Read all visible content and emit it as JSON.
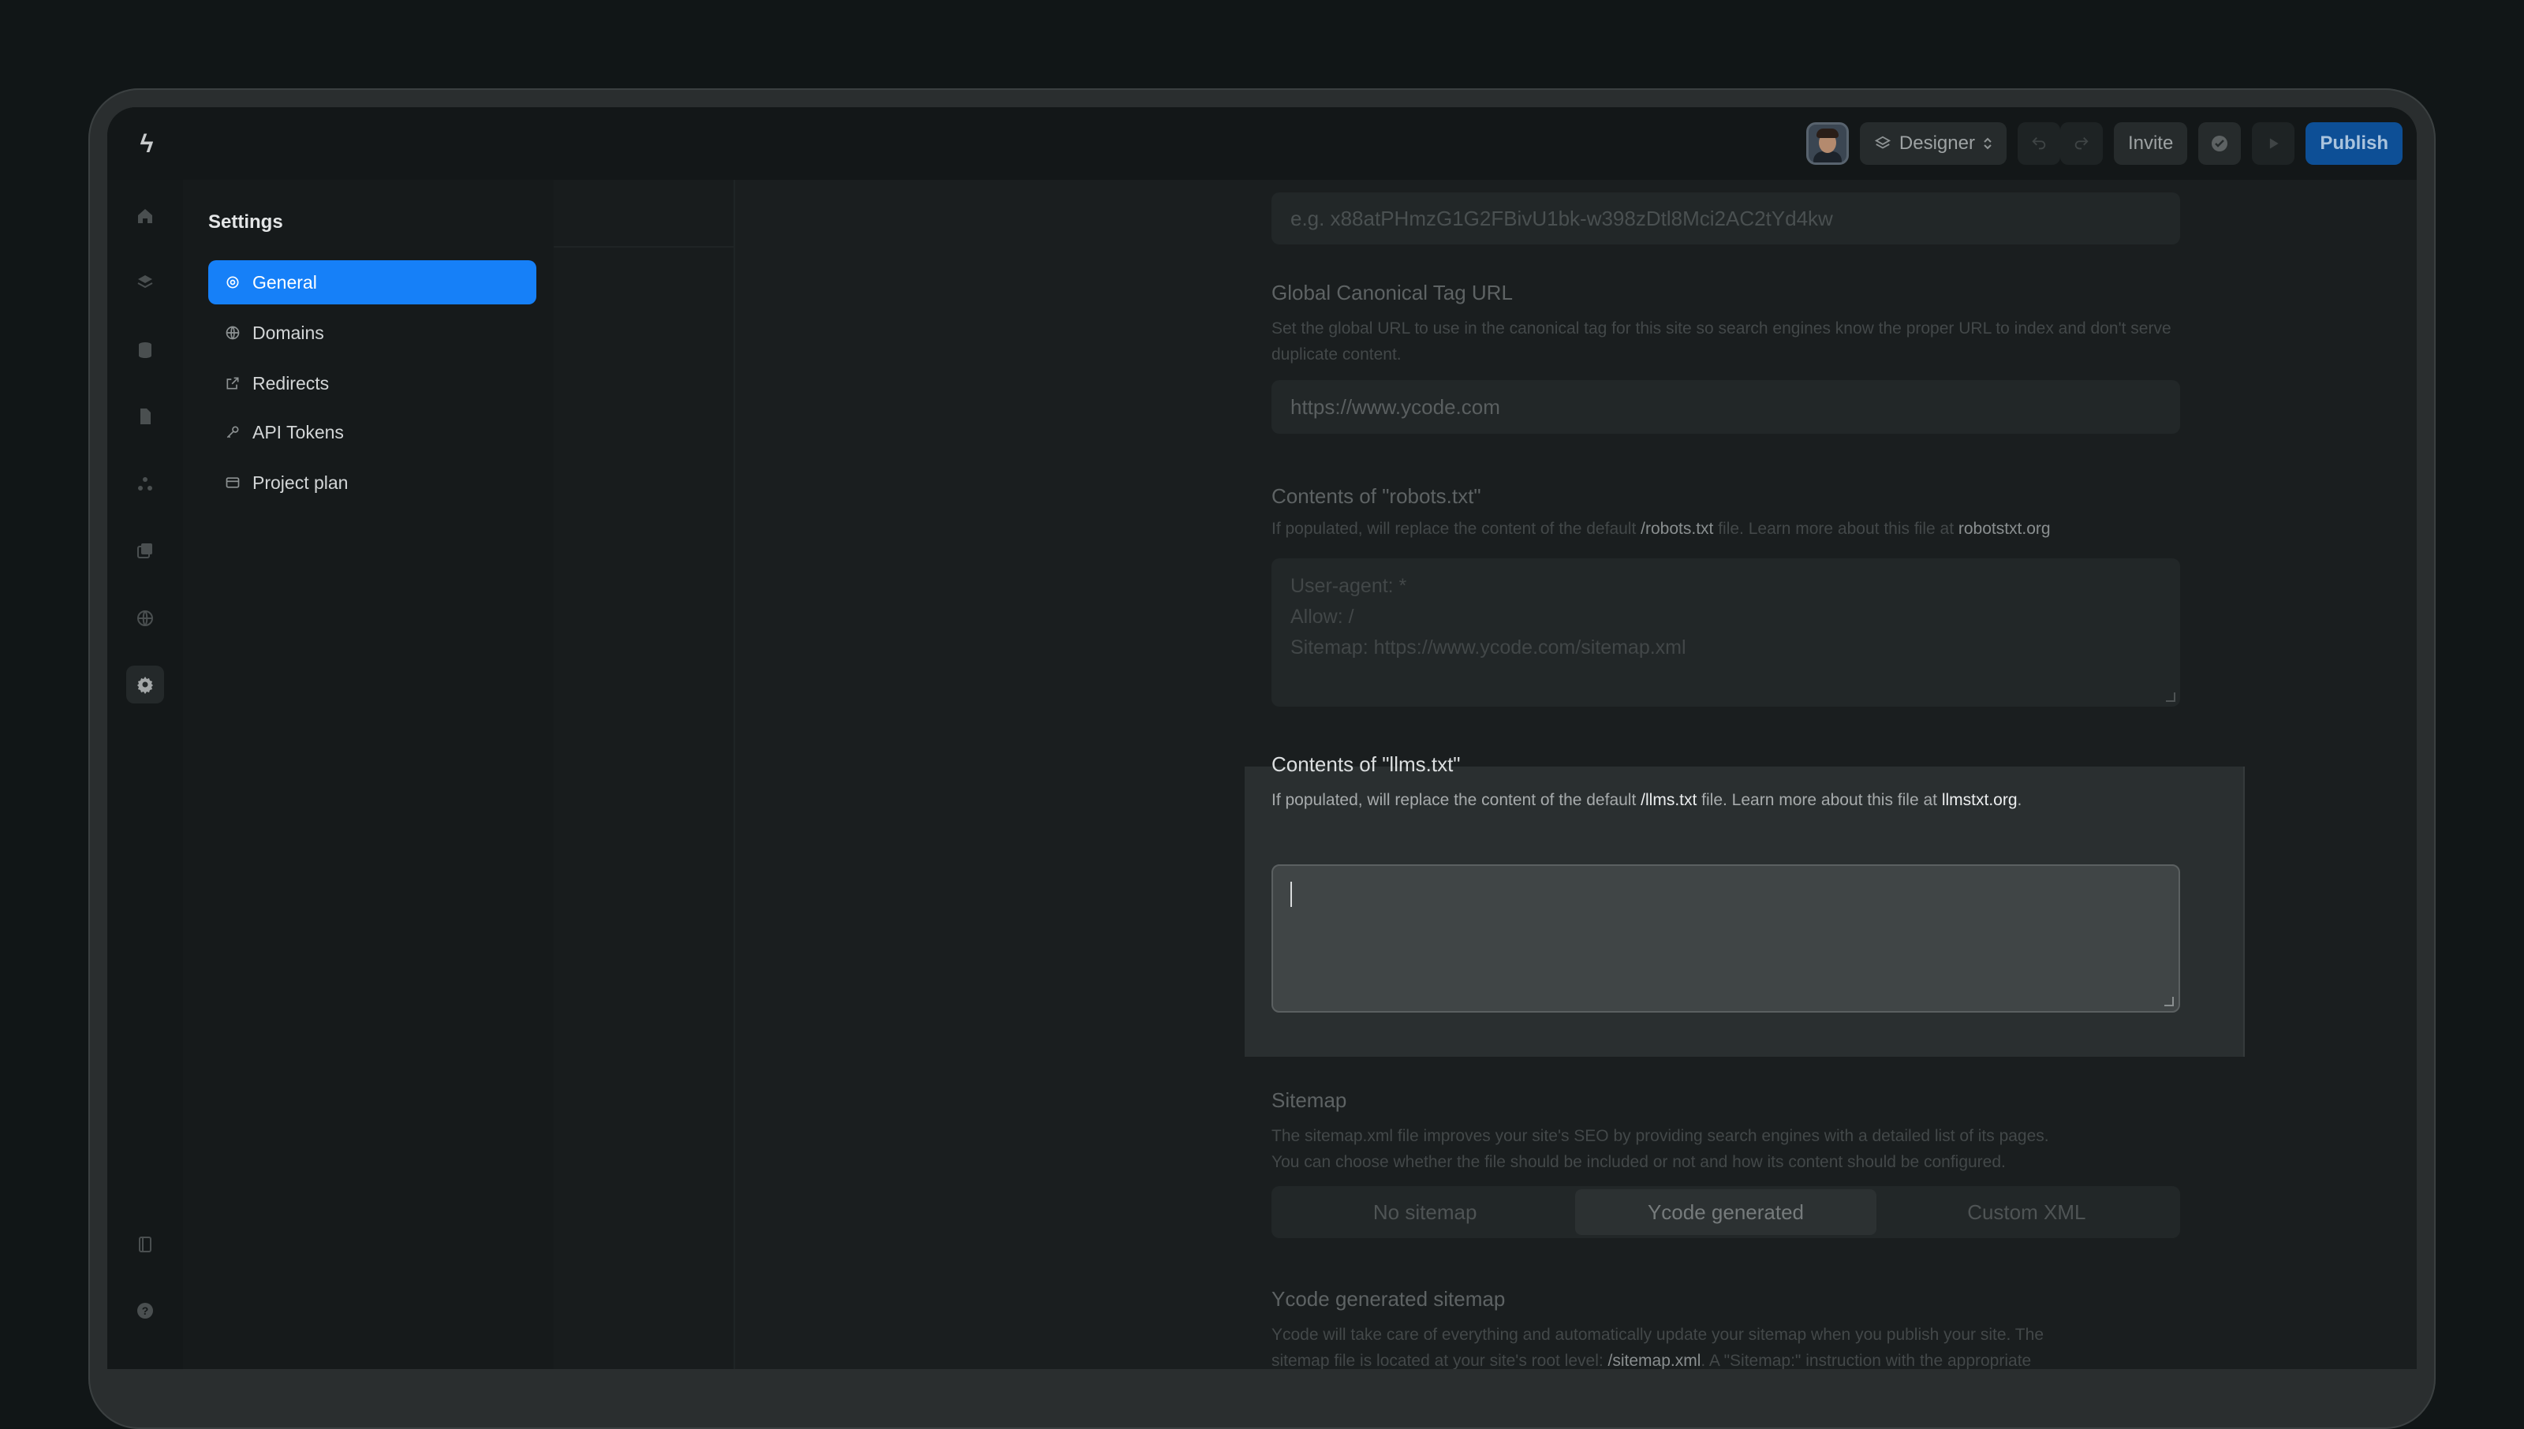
{
  "topbar": {
    "logo": "ϟ",
    "mode_label": "Designer",
    "invite_label": "Invite",
    "publish_label": "Publish"
  },
  "rail": [
    "home-icon",
    "layers-icon",
    "database-icon",
    "file-icon",
    "components-icon",
    "assets-icon",
    "globe-icon",
    "gear-icon",
    "book-icon",
    "help-icon"
  ],
  "settings": {
    "title": "Settings",
    "items": [
      {
        "label": "General",
        "icon": "gear-icon"
      },
      {
        "label": "Domains",
        "icon": "globe-icon"
      },
      {
        "label": "Redirects",
        "icon": "external-link-icon"
      },
      {
        "label": "API Tokens",
        "icon": "key-icon"
      },
      {
        "label": "Project plan",
        "icon": "credit-card-icon"
      }
    ]
  },
  "form": {
    "verification_placeholder": "e.g. x88atPHmzG1G2FBivU1bk-w398zDtl8Mci2AC2tYd4kw",
    "canonical": {
      "label": "Global Canonical Tag URL",
      "desc": "Set the global URL to use in the canonical tag for this site so search engines know the proper URL to index and don't serve duplicate content.",
      "placeholder": "https://www.ycode.com"
    },
    "robots": {
      "label": "Contents of \"robots.txt\"",
      "desc_pre": "If populated, will replace the content of the default ",
      "desc_file": "/robots.txt",
      "desc_mid": " file. Learn more about this file at ",
      "desc_link": "robotstxt.org",
      "placeholder_lines": [
        "User-agent: *",
        "Allow: /",
        "Sitemap: https://www.ycode.com/sitemap.xml"
      ]
    },
    "llms": {
      "label": "Contents of \"llms.txt\"",
      "desc_pre": "If populated, will replace the content of the default ",
      "desc_file": "/llms.txt",
      "desc_mid": " file. Learn more about this file at ",
      "desc_link": "llmstxt.org",
      "desc_end": ".",
      "value": ""
    },
    "sitemap": {
      "label": "Sitemap",
      "desc_1": "The sitemap.xml file improves your site's SEO by providing search engines with a detailed list of its pages.",
      "desc_2": "You can choose whether the file should be included or not and how its content should be configured.",
      "options": [
        "No sitemap",
        "Ycode generated",
        "Custom XML"
      ],
      "selected": "Ycode generated"
    },
    "generated": {
      "label": "Ycode generated sitemap",
      "desc_1": "Ycode will take care of everything and automatically update your sitemap when you publish your site. The",
      "desc_2_pre": "sitemap file is located at your site's root level: ",
      "desc_2_file": "/sitemap.xml",
      "desc_2_post": ". A \"Sitemap:\" instruction with the appropriate"
    }
  }
}
